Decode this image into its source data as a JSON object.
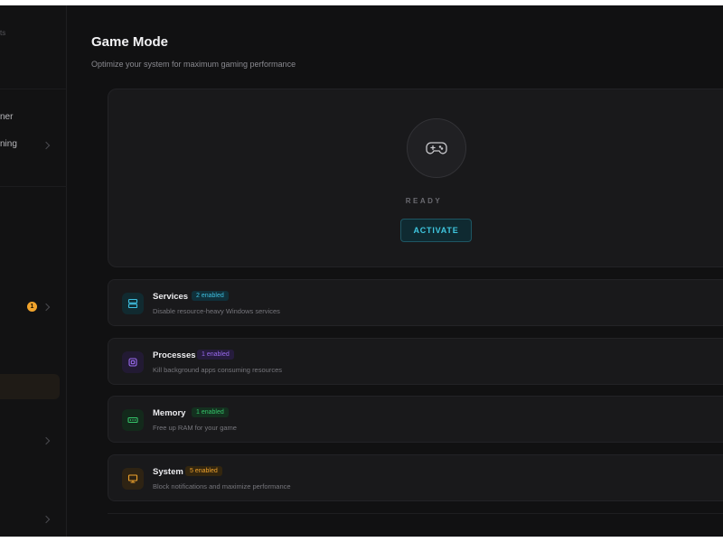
{
  "sidebar": {
    "items": [
      {
        "label": "ts",
        "faint": true
      },
      {
        "label": "ner"
      },
      {
        "label": "ning"
      }
    ],
    "badge_count": "1"
  },
  "page": {
    "title": "Game Mode",
    "subtitle": "Optimize your system for maximum gaming performance"
  },
  "hero": {
    "icon": "gamepad-icon",
    "status": "READY",
    "activate_label": "ACTIVATE"
  },
  "cards": [
    {
      "title": "Services",
      "badge": "2 enabled",
      "desc": "Disable resource-heavy Windows services",
      "icon": "server-icon",
      "color": "#3fbfe0"
    },
    {
      "title": "Processes",
      "badge": "1 enabled",
      "desc": "Kill background apps consuming resources",
      "icon": "cpu-icon",
      "color": "#9a6bf0"
    },
    {
      "title": "Memory",
      "badge": "1 enabled",
      "desc": "Free up RAM for your game",
      "icon": "memory-icon",
      "color": "#35c46a"
    },
    {
      "title": "System",
      "badge": "5 enabled",
      "desc": "Block notifications and maximize performance",
      "icon": "monitor-icon",
      "color": "#f0a32c"
    }
  ],
  "colors": {
    "background": "#111112",
    "accent": "#3fc7e0"
  }
}
